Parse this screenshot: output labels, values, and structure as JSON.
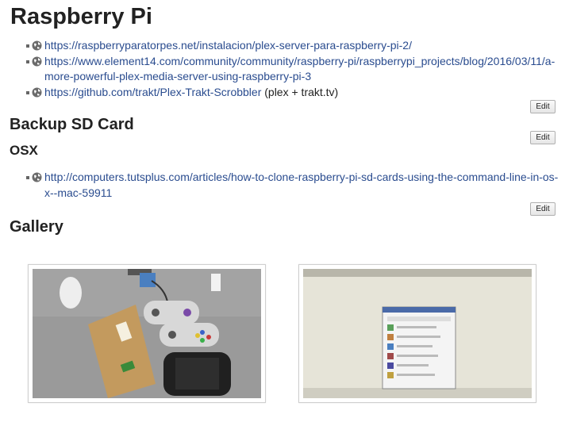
{
  "page": {
    "title": "Raspberry Pi"
  },
  "sections": {
    "top_links": [
      {
        "url": "https://raspberryparatorpes.net/instalacion/plex-server-para-raspberry-pi-2/",
        "suffix": ""
      },
      {
        "url": "https://www.element14.com/community/community/raspberry-pi/raspberrypi_projects/blog/2016/03/11/a-more-powerful-plex-media-server-using-raspberry-pi-3",
        "suffix": ""
      },
      {
        "url": "https://github.com/trakt/Plex-Trakt-Scrobbler",
        "suffix": " (plex + trakt.tv)"
      }
    ],
    "backup": {
      "title": "Backup SD Card",
      "osx_title": "OSX",
      "links": [
        {
          "url": "http://computers.tutsplus.com/articles/how-to-clone-raspberry-pi-sd-cards-using-the-command-line-in-os-x--mac-59911"
        }
      ]
    },
    "gallery": {
      "title": "Gallery"
    }
  },
  "edit_label": "Edit",
  "icons": {
    "link": "globe-icon"
  },
  "colors": {
    "link": "#2a4c8f",
    "text": "#222222"
  }
}
